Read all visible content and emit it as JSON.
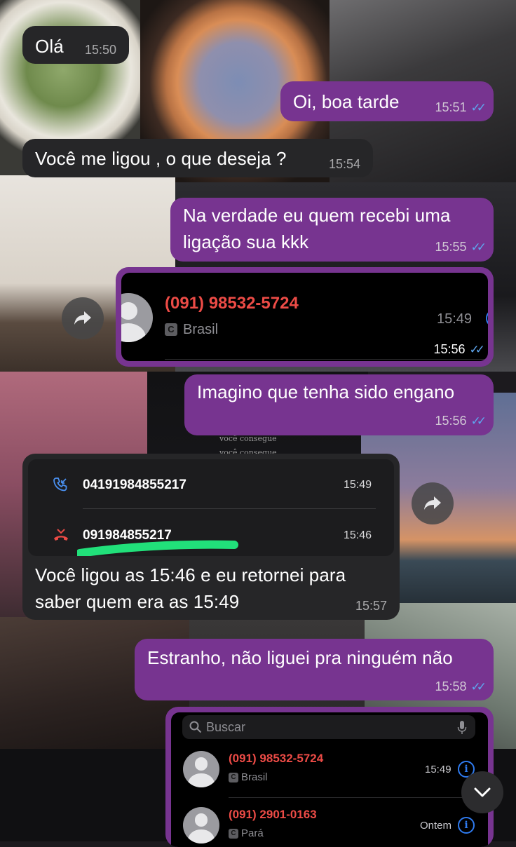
{
  "messages": [
    {
      "text": "Olá",
      "time": "15:50",
      "dir": "in"
    },
    {
      "text": "Oi, boa tarde",
      "time": "15:51",
      "dir": "out"
    },
    {
      "text": "Você me ligou , o que deseja ?",
      "time": "15:54",
      "dir": "in"
    },
    {
      "text_line1": "Na verdade eu quem recebi uma",
      "text_line2": "ligação sua kkk",
      "time": "15:55",
      "dir": "out"
    },
    {
      "time": "15:56",
      "dir": "out"
    },
    {
      "text": "Imagino que tenha sido engano",
      "time": "15:56",
      "dir": "out"
    },
    {
      "text_line1": "Você ligou as 15:46 e eu retornei para",
      "text_line2": "saber quem era as 15:49",
      "time": "15:57",
      "dir": "in"
    },
    {
      "text": "Estranho, não liguei pra ninguém não",
      "time": "15:58",
      "dir": "out"
    }
  ],
  "call_image_1": {
    "number": "(091) 98532-5724",
    "region": "Brasil",
    "time": "15:49",
    "badge": "C"
  },
  "call_log_image": {
    "rows": [
      {
        "number": "04191984855217",
        "time": "15:49"
      },
      {
        "number": "091984855217",
        "time": "15:46"
      }
    ]
  },
  "contacts_image": {
    "search_placeholder": "Buscar",
    "rows": [
      {
        "number": "(091) 98532-5724",
        "region": "Brasil",
        "time": "15:49",
        "badge": "C"
      },
      {
        "number": "(091) 2901-0163",
        "region": "Pará",
        "time": "Ontem",
        "badge": "C"
      }
    ]
  },
  "wallpaper_text": {
    "line1": "você consegue",
    "line2": "você consegue"
  },
  "colors": {
    "outgoing": "#773490",
    "incoming": "#262628",
    "read_ticks": "#5ea6ef",
    "missed": "#ec4b46"
  },
  "icons": [
    "forward-icon",
    "read-ticks-icon",
    "incoming-call-icon",
    "missed-call-icon",
    "search-icon",
    "microphone-icon",
    "info-icon",
    "chevron-down-icon"
  ]
}
